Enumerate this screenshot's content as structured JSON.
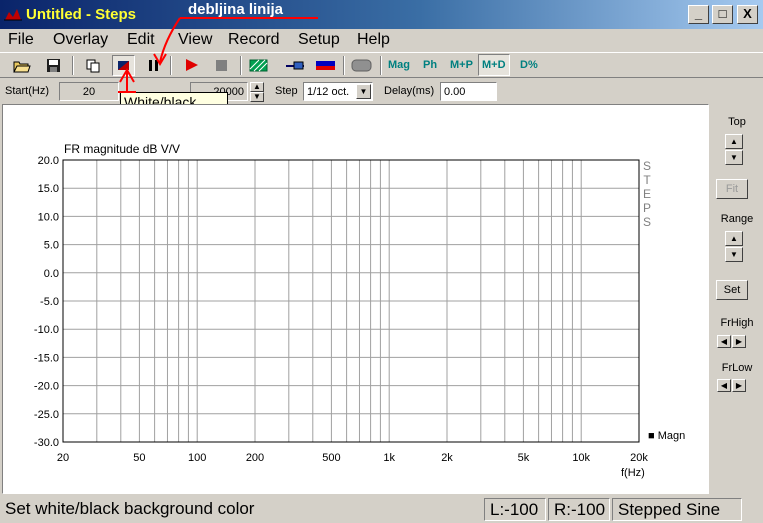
{
  "window": {
    "title": "Untitled - Steps",
    "minimize_label": "_",
    "maximize_label": "□",
    "close_label": "X"
  },
  "annotation": {
    "text": "debljina linija",
    "color": "#ff0000"
  },
  "menu": [
    "File",
    "Overlay",
    "Edit",
    "View",
    "Record",
    "Setup",
    "Help"
  ],
  "toolbar": {
    "icons": [
      "open-icon",
      "save-icon",
      "copy-icon",
      "white-black-icon",
      "line-width-icon",
      "record-icon",
      "stop-icon",
      "pattern-icon",
      "probe-icon",
      "color-bar-icon",
      "gray-button-icon"
    ],
    "text_buttons": [
      "Mag",
      "Ph",
      "M+P",
      "M+D",
      "D%"
    ],
    "pressed_text_button": "M+D"
  },
  "params": {
    "start_label": "Start(Hz)",
    "start_value": "20",
    "stop_value": "20000",
    "step_label": "Step",
    "step_value": "1/12 oct.",
    "delay_label": "Delay(ms)",
    "delay_value": "0.00"
  },
  "tooltip": "White/black",
  "chart_data": {
    "type": "line",
    "title": "FR magnitude dB V/V",
    "xlabel": "f(Hz)",
    "ylabel": "",
    "x_scale": "log",
    "xlim": [
      20,
      20000
    ],
    "ylim": [
      -30,
      20
    ],
    "x_ticks": [
      {
        "value": 20,
        "label": "20"
      },
      {
        "value": 50,
        "label": "50"
      },
      {
        "value": 100,
        "label": "100"
      },
      {
        "value": 200,
        "label": "200"
      },
      {
        "value": 500,
        "label": "500"
      },
      {
        "value": 1000,
        "label": "1k"
      },
      {
        "value": 2000,
        "label": "2k"
      },
      {
        "value": 5000,
        "label": "5k"
      },
      {
        "value": 10000,
        "label": "10k"
      },
      {
        "value": 20000,
        "label": "20k"
      }
    ],
    "y_ticks": [
      {
        "value": 20,
        "label": "20.0"
      },
      {
        "value": 15,
        "label": "15.0"
      },
      {
        "value": 10,
        "label": "10.0"
      },
      {
        "value": 5,
        "label": "5.0"
      },
      {
        "value": 0,
        "label": "0.0"
      },
      {
        "value": -5,
        "label": "-5.0"
      },
      {
        "value": -10,
        "label": "-10.0"
      },
      {
        "value": -15,
        "label": "-15.0"
      },
      {
        "value": -20,
        "label": "-20.0"
      },
      {
        "value": -25,
        "label": "-25.0"
      },
      {
        "value": -30,
        "label": "-30.0"
      }
    ],
    "grid": true,
    "series": [
      {
        "name": "Magn",
        "values": []
      }
    ],
    "legend_marker": "■ Magn",
    "watermark": [
      "S",
      "T",
      "E",
      "P",
      "S"
    ]
  },
  "right_panel": {
    "top_label": "Top",
    "fit_label": "Fit",
    "range_label": "Range",
    "set_label": "Set",
    "frhigh_label": "FrHigh",
    "frlow_label": "FrLow"
  },
  "status": {
    "message": "Set white/black background color",
    "left": "L:-100",
    "right": "R:-100",
    "mode": "Stepped Sine"
  }
}
